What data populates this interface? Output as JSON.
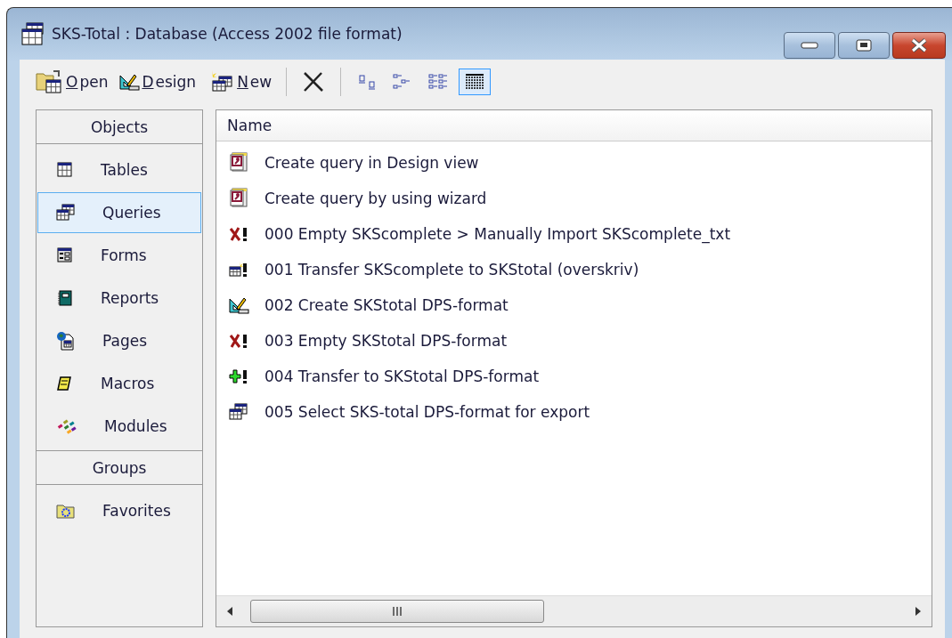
{
  "window": {
    "title": "SKS-Total : Database (Access 2002 file format)"
  },
  "toolbar": {
    "commands": [
      {
        "kind": "open",
        "label": "Open"
      },
      {
        "kind": "design",
        "label": "Design"
      },
      {
        "kind": "new",
        "label": "New"
      }
    ],
    "views": [
      {
        "kind": "large-icons",
        "selected": false
      },
      {
        "kind": "small-icons",
        "selected": false
      },
      {
        "kind": "list",
        "selected": false
      },
      {
        "kind": "details",
        "selected": true
      }
    ]
  },
  "objects_bar": {
    "objects_header": "Objects",
    "objects": [
      {
        "kind": "tables",
        "label": "Tables",
        "selected": false
      },
      {
        "kind": "queries",
        "label": "Queries",
        "selected": true
      },
      {
        "kind": "forms",
        "label": "Forms",
        "selected": false
      },
      {
        "kind": "reports",
        "label": "Reports",
        "selected": false
      },
      {
        "kind": "pages",
        "label": "Pages",
        "selected": false
      },
      {
        "kind": "macros",
        "label": "Macros",
        "selected": false
      },
      {
        "kind": "modules",
        "label": "Modules",
        "selected": false
      }
    ],
    "groups_header": "Groups",
    "groups": [
      {
        "kind": "favorites",
        "label": "Favorites",
        "selected": false
      }
    ]
  },
  "list": {
    "columns": [
      "Name"
    ],
    "rows": [
      {
        "kind": "shortcut",
        "name": "Create query in Design view"
      },
      {
        "kind": "shortcut",
        "name": "Create query by using wizard"
      },
      {
        "kind": "delete",
        "name": "000 Empty SKScomplete > Manually Import SKScomplete_txt"
      },
      {
        "kind": "make-table",
        "name": "001 Transfer SKScomplete to SKStotal (overskriv)"
      },
      {
        "kind": "design",
        "name": "002 Create SKStotal DPS-format"
      },
      {
        "kind": "delete",
        "name": "003 Empty SKStotal DPS-format"
      },
      {
        "kind": "append",
        "name": "004 Transfer to SKStotal DPS-format"
      },
      {
        "kind": "select",
        "name": "005 Select SKS-total DPS-format for export"
      }
    ]
  }
}
